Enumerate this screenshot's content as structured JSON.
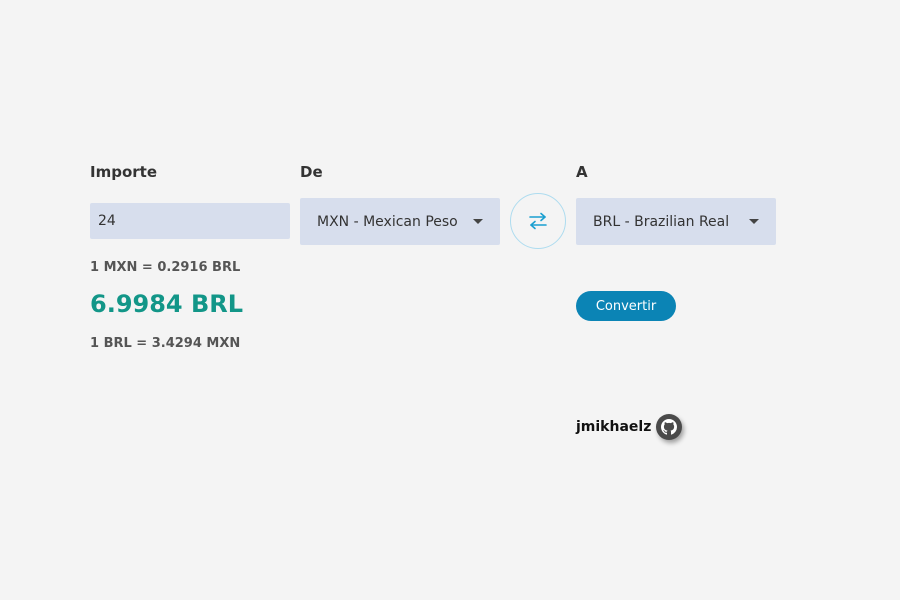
{
  "labels": {
    "amount": "Importe",
    "from": "De",
    "to": "A"
  },
  "amount": {
    "value": "24"
  },
  "from": {
    "selected": "MXN - Mexican Peso"
  },
  "to": {
    "selected": "BRL - Brazilian Real"
  },
  "swap": {
    "icon": "swap-arrows-icon"
  },
  "rates": {
    "forward": "1 MXN = 0.2916 BRL",
    "inverse": "1 BRL = 3.4294 MXN"
  },
  "result": "6.9984 BRL",
  "convert_label": "Convertir",
  "author": {
    "name": "jmikhaelz",
    "icon": "github-icon"
  },
  "colors": {
    "background": "#f4f4f4",
    "field": "#d7deed",
    "result": "#129688",
    "button": "#0b84b5",
    "swap_accent": "#1a9fd0"
  }
}
